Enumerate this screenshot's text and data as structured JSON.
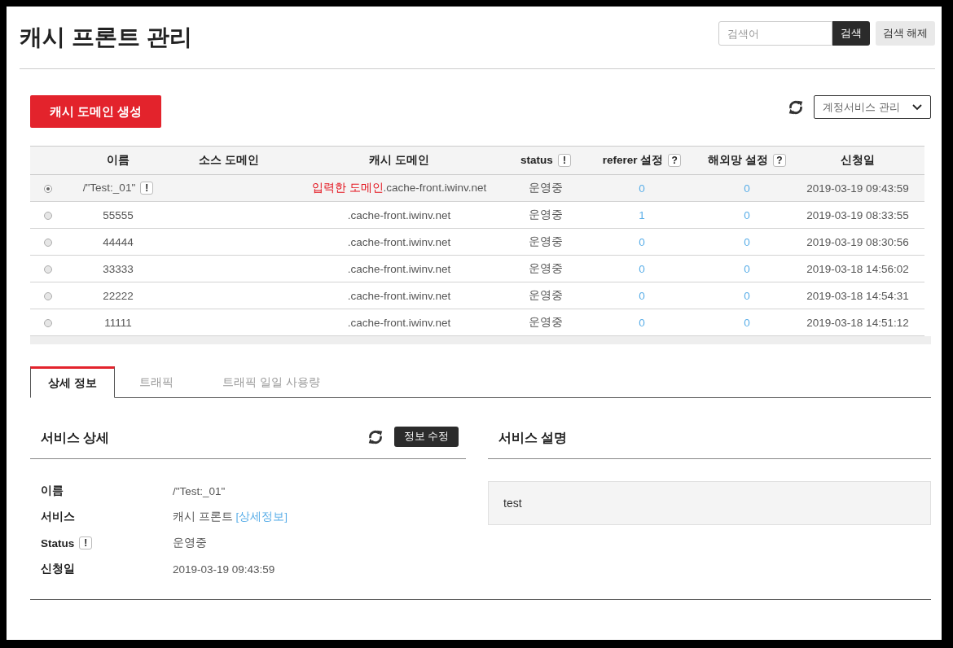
{
  "page": {
    "title": "캐시 프론트 관리"
  },
  "search": {
    "placeholder": "검색어",
    "button": "검색",
    "clear_button": "검색 해제"
  },
  "toolbar": {
    "create_button": "캐시 도메인 생성",
    "account_dropdown": "계정서비스 관리"
  },
  "table": {
    "columns": [
      {
        "label": "이름"
      },
      {
        "label": "소스 도메인"
      },
      {
        "label": "캐시 도메인"
      },
      {
        "label": "status",
        "badge": "!"
      },
      {
        "label": "referer 설정",
        "badge": "?"
      },
      {
        "label": "해외망 설정",
        "badge": "?"
      },
      {
        "label": "신청일"
      }
    ],
    "rows": [
      {
        "selected": true,
        "name": "/\"Test:_01\"",
        "name_badge": "!",
        "cache_domain_hint": "입력한 도메인",
        "cache_domain": ".cache-front.iwinv.net",
        "status": "운영중",
        "referer": "0",
        "overseas": "0",
        "date": "2019-03-19 09:43:59"
      },
      {
        "selected": false,
        "name": "55555",
        "cache_domain": ".cache-front.iwinv.net",
        "status": "운영중",
        "referer": "1",
        "overseas": "0",
        "date": "2019-03-19 08:33:55"
      },
      {
        "selected": false,
        "name": "44444",
        "cache_domain": ".cache-front.iwinv.net",
        "status": "운영중",
        "referer": "0",
        "overseas": "0",
        "date": "2019-03-19 08:30:56"
      },
      {
        "selected": false,
        "name": "33333",
        "cache_domain": ".cache-front.iwinv.net",
        "status": "운영중",
        "referer": "0",
        "overseas": "0",
        "date": "2019-03-18 14:56:02"
      },
      {
        "selected": false,
        "name": "22222",
        "cache_domain": ".cache-front.iwinv.net",
        "status": "운영중",
        "referer": "0",
        "overseas": "0",
        "date": "2019-03-18 14:54:31"
      },
      {
        "selected": false,
        "name": "11111",
        "cache_domain": ".cache-front.iwinv.net",
        "status": "운영중",
        "referer": "0",
        "overseas": "0",
        "date": "2019-03-18 14:51:12"
      }
    ]
  },
  "tabs": [
    {
      "label": "상세 정보",
      "selected": true
    },
    {
      "label": "트래픽",
      "selected": false
    },
    {
      "label": "트래픽 일일 사용량",
      "selected": false
    }
  ],
  "detail": {
    "title": "서비스 상세",
    "edit_button": "정보 수정",
    "fields": [
      {
        "label": "이름",
        "value": "/\"Test:_01\""
      },
      {
        "label": "서비스",
        "value": "캐시 프론트",
        "link": "[상세정보]"
      },
      {
        "label": "Status",
        "badge": "!",
        "value": "운영중"
      },
      {
        "label": "신청일",
        "value": "2019-03-19 09:43:59"
      }
    ]
  },
  "description": {
    "title": "서비스 설명",
    "text": "test"
  }
}
